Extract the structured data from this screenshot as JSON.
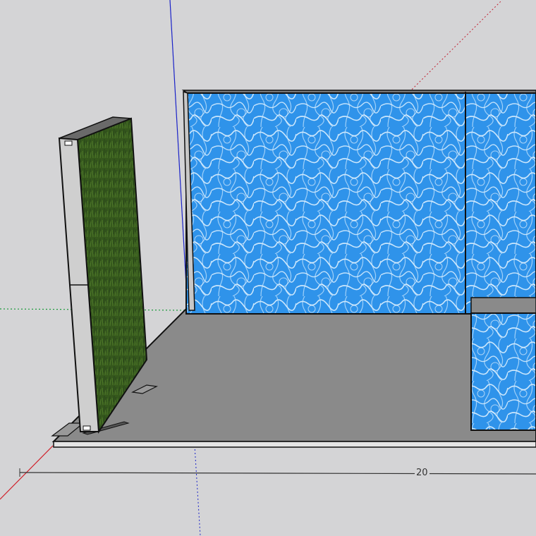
{
  "viewport": {
    "background": "#d4d4d6",
    "dimension_label": "20"
  },
  "materials": {
    "water": "#2f93ea",
    "water_highlight": "#e8f6ff",
    "grass": "#35581c",
    "floor": "#8a8a8a",
    "frame": "#c8c8c8"
  },
  "axes": {
    "red": "#d0202a",
    "green": "#1a9a3a",
    "blue": "#1a22c8"
  }
}
